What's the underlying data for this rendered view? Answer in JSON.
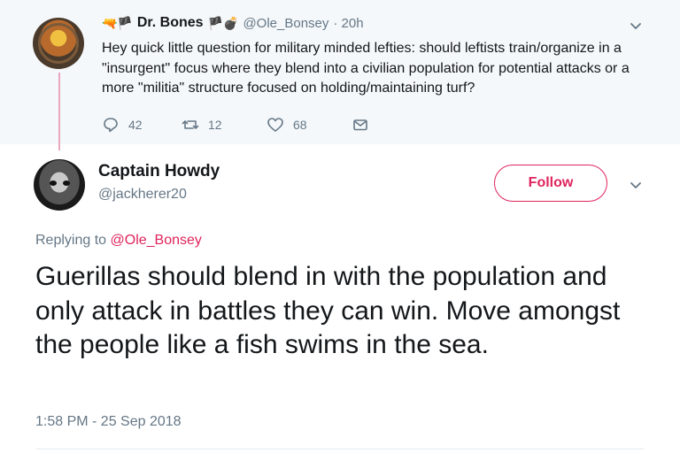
{
  "parent_tweet": {
    "emoji_prefix": "🔫🏴",
    "name": "Dr. Bones",
    "emoji_suffix": "🏴💣",
    "handle": "@Ole_Bonsey",
    "time": "· 20h",
    "text": "Hey quick little question for military minded lefties: should leftists train/organize in a \"insurgent\" focus where they blend into a civilian population for potential attacks or a more \"militia\" structure focused on holding/maintaining turf?",
    "replies": "42",
    "retweets": "12",
    "likes": "68"
  },
  "main_tweet": {
    "name": "Captain Howdy",
    "handle": "@jackherer20",
    "follow_label": "Follow",
    "replying_prefix": "Replying to ",
    "replying_to": "@Ole_Bonsey",
    "text": "Guerillas should blend in with the population and only attack in battles they can win. Move amongst the people like a fish swims in the sea.",
    "timestamp": "1:58 PM - 25 Sep 2018"
  },
  "colors": {
    "accent": "#e0245e",
    "muted": "#657786",
    "parent_bg": "#f5f8fa",
    "thread_line": "#e8a7bd"
  },
  "icons": [
    "reply-icon",
    "retweet-icon",
    "like-icon",
    "message-icon",
    "chevron-down-icon"
  ]
}
